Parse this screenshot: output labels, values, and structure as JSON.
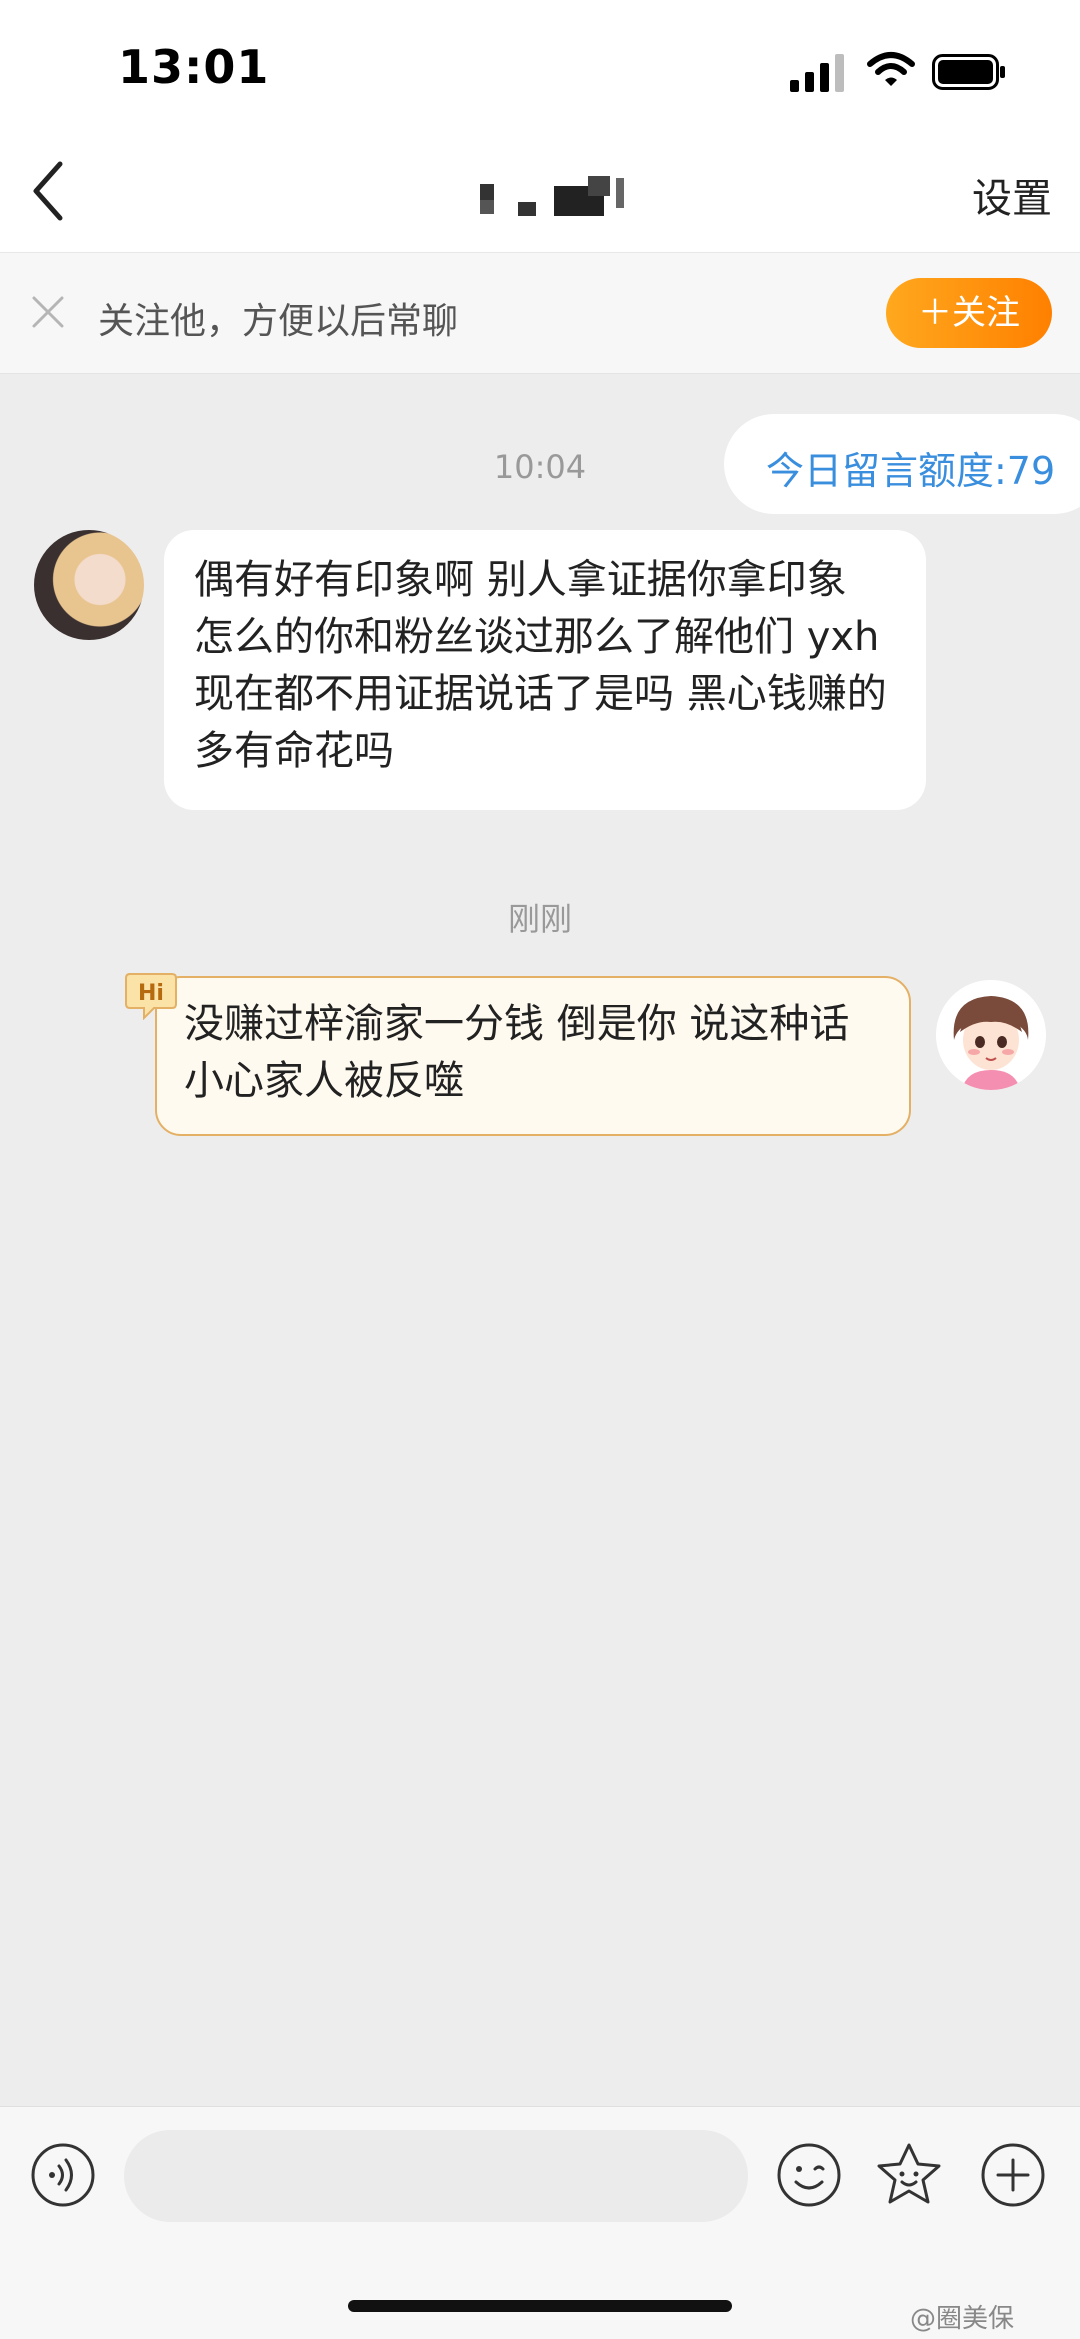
{
  "status_bar": {
    "time": "13:01"
  },
  "nav": {
    "settings_label": "设置"
  },
  "banner": {
    "text": "关注他，方便以后常聊",
    "follow_label": "＋关注"
  },
  "quota": {
    "text": "今日留言额度:79"
  },
  "messages": [
    {
      "timestamp": "10:04",
      "direction": "received",
      "text": "偶有好有印象啊 别人拿证据你拿印象 怎么的你和粉丝谈过那么了解他们 yxh 现在都不用证据说话了是吗 黑心钱赚的多有命花吗"
    },
    {
      "timestamp": "刚刚",
      "direction": "sent",
      "badge": "Hi",
      "text": "没赚过梓渝家一分钱 倒是你 说这种话小心家人被反噬"
    }
  ],
  "input": {
    "placeholder": ""
  },
  "watermark": "@圈美保",
  "icons": {
    "back": "chevron-left-icon",
    "close": "close-icon",
    "voice": "voice-icon",
    "emoji": "emoji-icon",
    "sticker": "sticker-icon",
    "plus": "plus-icon"
  },
  "colors": {
    "accent": "#ff8c00",
    "quota_text": "#3a8ede",
    "sent_bubble_border": "#e3b065"
  }
}
